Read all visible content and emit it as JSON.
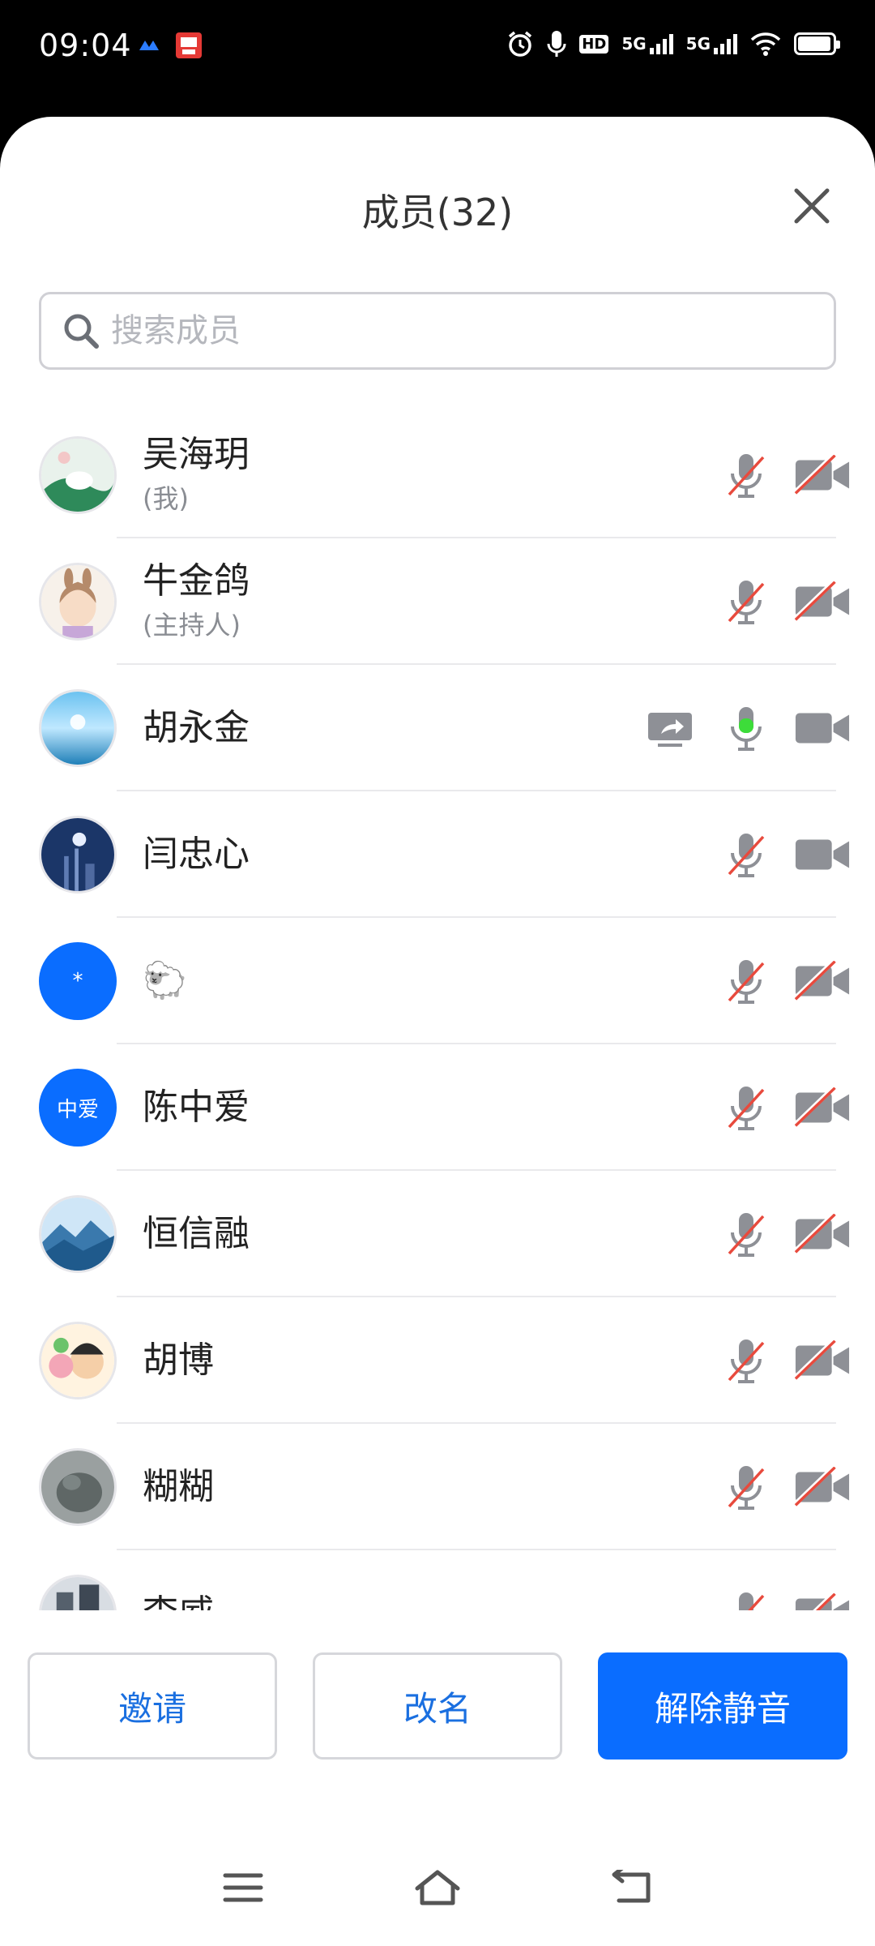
{
  "status_bar": {
    "time": "09:04",
    "network_labels": [
      "5G",
      "5G"
    ],
    "hd_label": "HD"
  },
  "header": {
    "title": "成员(32)"
  },
  "search": {
    "placeholder": "搜索成员",
    "value": ""
  },
  "members": [
    {
      "name": "吴海玥",
      "role": "(我)",
      "mic": "muted",
      "camera": "off",
      "sharing": false
    },
    {
      "name": "牛金鸽",
      "role": "(主持人)",
      "mic": "muted",
      "camera": "off",
      "sharing": false
    },
    {
      "name": "胡永金",
      "role": "",
      "mic": "active",
      "camera": "on",
      "sharing": true
    },
    {
      "name": "闫忠心",
      "role": "",
      "mic": "muted",
      "camera": "on",
      "sharing": false
    },
    {
      "name": "🐑",
      "role": "",
      "mic": "muted",
      "camera": "off",
      "sharing": false,
      "avatar_text": "*"
    },
    {
      "name": "陈中爱",
      "role": "",
      "mic": "muted",
      "camera": "off",
      "sharing": false,
      "avatar_text": "中爱"
    },
    {
      "name": "恒信融",
      "role": "",
      "mic": "muted",
      "camera": "off",
      "sharing": false
    },
    {
      "name": "胡博",
      "role": "",
      "mic": "muted",
      "camera": "off",
      "sharing": false
    },
    {
      "name": "糊糊",
      "role": "",
      "mic": "muted",
      "camera": "off",
      "sharing": false
    },
    {
      "name": "李威",
      "role": "",
      "mic": "muted",
      "camera": "off",
      "sharing": false
    }
  ],
  "buttons": {
    "invite": "邀请",
    "rename": "改名",
    "unmute": "解除静音"
  },
  "colors": {
    "accent": "#0A6DFF",
    "icon_gray": "#8E9096",
    "mute_slash": "#E84A3D",
    "mic_active": "#3DDC3A"
  }
}
